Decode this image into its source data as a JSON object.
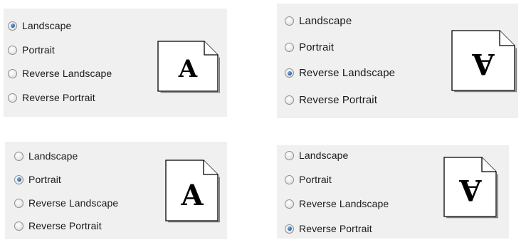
{
  "panels": [
    {
      "id": "landscape",
      "options": [
        {
          "label": "Landscape",
          "checked": true
        },
        {
          "label": "Portrait",
          "checked": false
        },
        {
          "label": "Reverse Landscape",
          "checked": false
        },
        {
          "label": "Reverse Portrait",
          "checked": false
        }
      ],
      "preview_letter": "A",
      "preview_flipped": false
    },
    {
      "id": "reverse-landscape",
      "options": [
        {
          "label": "Landscape",
          "checked": false
        },
        {
          "label": "Portrait",
          "checked": false
        },
        {
          "label": "Reverse Landscape",
          "checked": true
        },
        {
          "label": "Reverse Portrait",
          "checked": false
        }
      ],
      "preview_letter": "A",
      "preview_flipped": true
    },
    {
      "id": "portrait",
      "options": [
        {
          "label": "Landscape",
          "checked": false
        },
        {
          "label": "Portrait",
          "checked": true
        },
        {
          "label": "Reverse Landscape",
          "checked": false
        },
        {
          "label": "Reverse Portrait",
          "checked": false
        }
      ],
      "preview_letter": "A",
      "preview_flipped": false
    },
    {
      "id": "reverse-portrait",
      "options": [
        {
          "label": "Landscape",
          "checked": false
        },
        {
          "label": "Portrait",
          "checked": false
        },
        {
          "label": "Reverse Landscape",
          "checked": false
        },
        {
          "label": "Reverse Portrait",
          "checked": true
        }
      ],
      "preview_letter": "A",
      "preview_flipped": true
    }
  ],
  "colors": {
    "panel_background": "#f0f0f0",
    "radio_selected": "#2a68b0"
  }
}
